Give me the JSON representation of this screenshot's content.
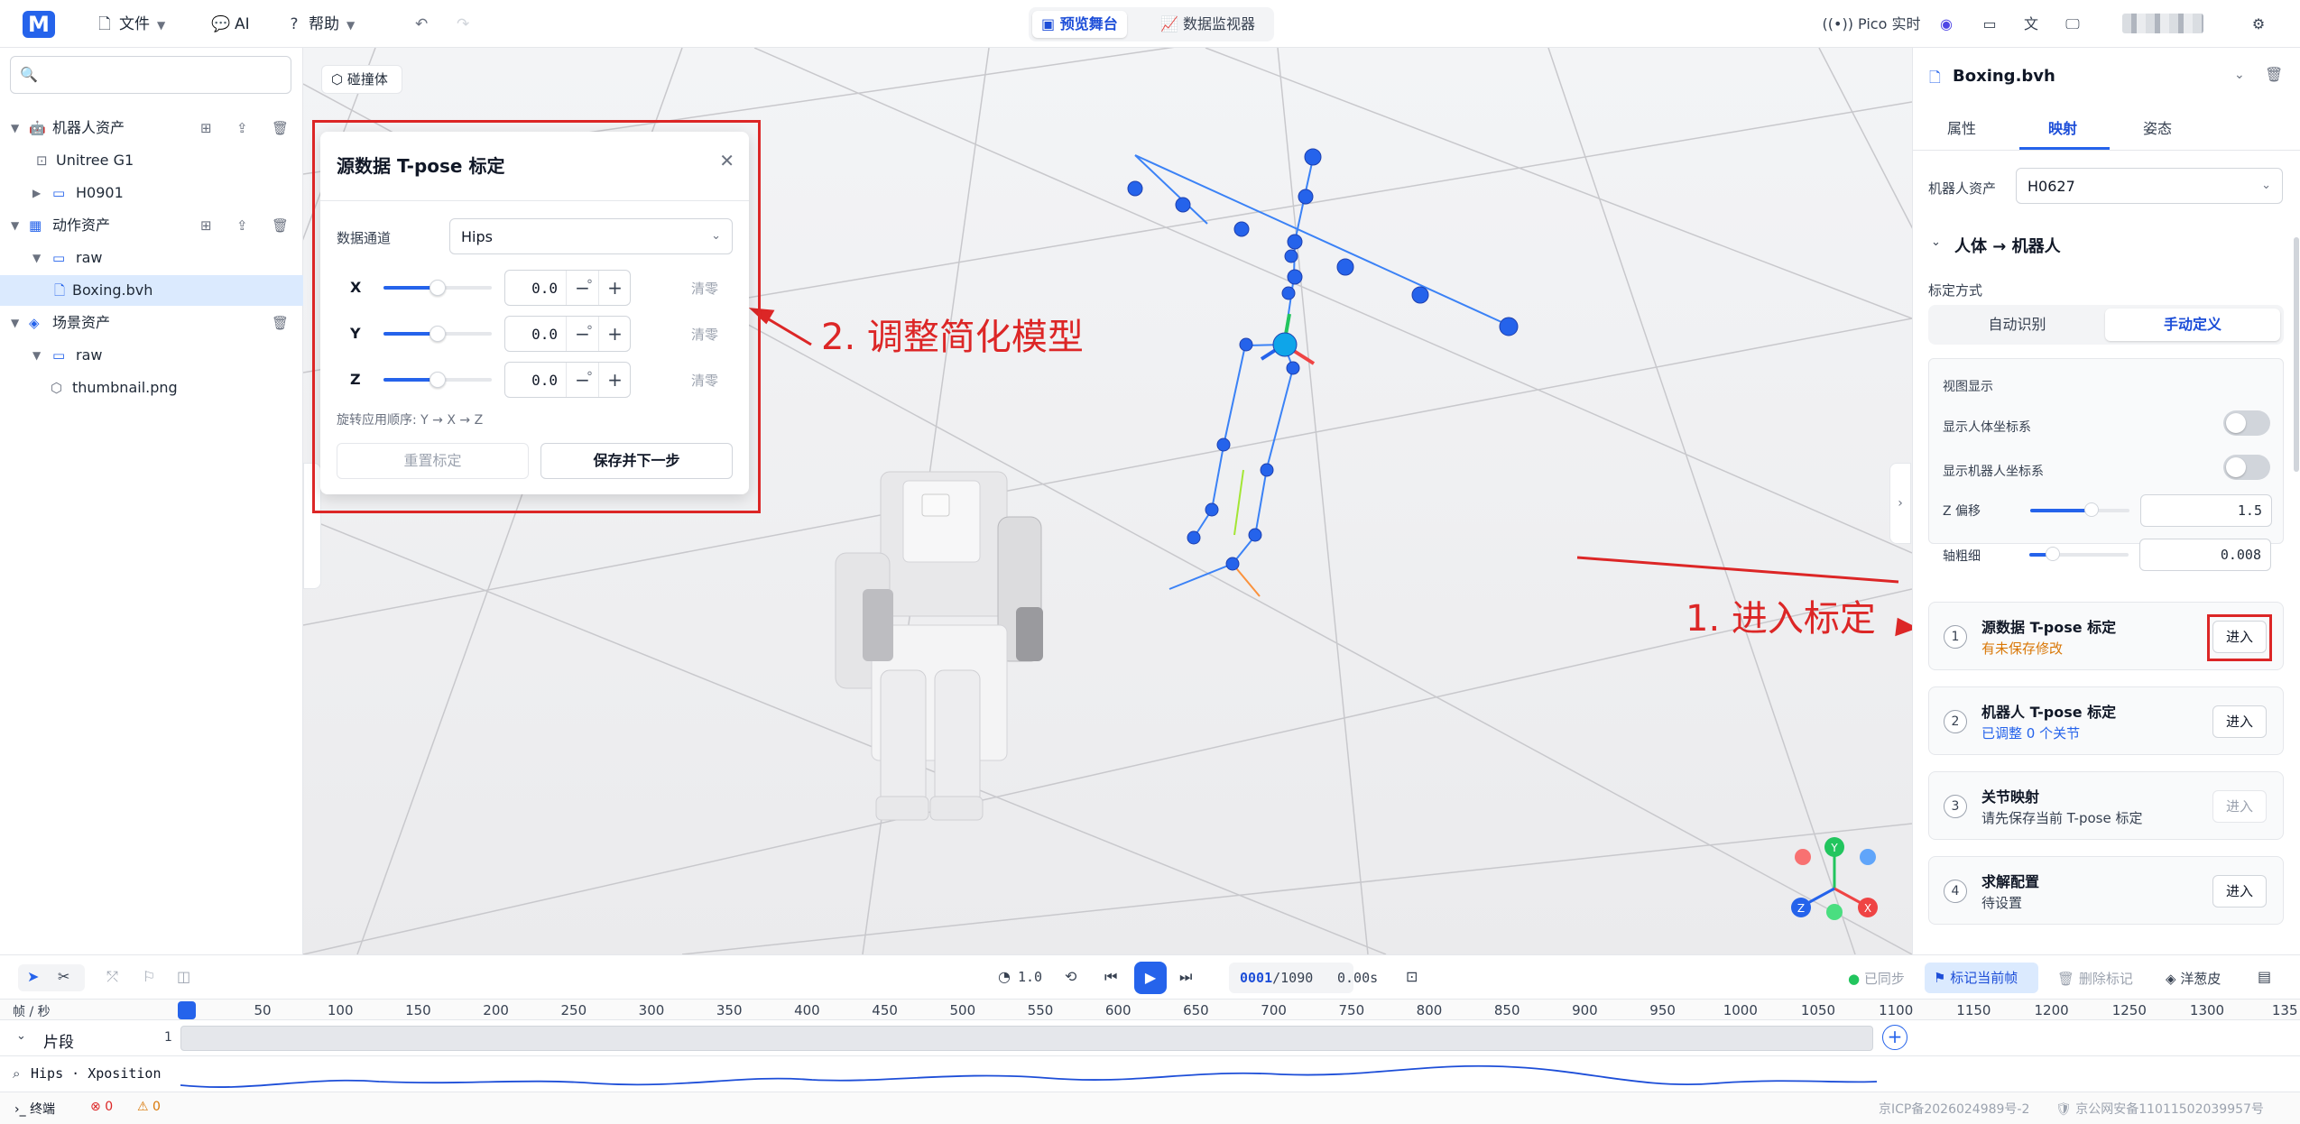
{
  "topbar": {
    "logo": "M",
    "file_label": "文件",
    "ai_label": "AI",
    "help_label": "帮助",
    "tab_preview": "预览舞台",
    "tab_monitor": "数据监视器",
    "pico_label": "Pico 实时"
  },
  "left": {
    "search_placeholder": "",
    "robot_assets": "机器人资产",
    "robot_1": "Unitree G1",
    "robot_2": "H0901",
    "motion_assets": "动作资产",
    "motion_folder": "raw",
    "motion_file": "Boxing.bvh",
    "scene_assets": "场景资产",
    "scene_folder": "raw",
    "scene_file": "thumbnail.png"
  },
  "viewport": {
    "collide_label": "碰撞体",
    "annotation_1": "1. 进入标定",
    "annotation_2": "2. 调整简化模型",
    "gizmo": {
      "y": "Y",
      "x": "X",
      "z": "Z"
    }
  },
  "dialog": {
    "title": "源数据 T-pose 标定",
    "channel_label": "数据通道",
    "channel_value": "Hips",
    "axes": [
      {
        "label": "X",
        "value": "0.0",
        "unit": "°",
        "clear": "清零"
      },
      {
        "label": "Y",
        "value": "0.0",
        "unit": "°",
        "clear": "清零"
      },
      {
        "label": "Z",
        "value": "0.0",
        "unit": "°",
        "clear": "清零"
      }
    ],
    "order_hint": "旋转应用顺序: Y → X → Z",
    "reset_label": "重置标定",
    "save_label": "保存并下一步"
  },
  "right": {
    "file_title": "Boxing.bvh",
    "tab_props": "属性",
    "tab_mapping": "映射",
    "tab_pose": "姿态",
    "robot_asset_label": "机器人资产",
    "robot_asset_value": "H0627",
    "section_title": "人体 → 机器人",
    "calib_mode_label": "标定方式",
    "mode_auto": "自动识别",
    "mode_manual": "手动定义",
    "view_display": "视图显示",
    "show_human_axes": "显示人体坐标系",
    "show_robot_axes": "显示机器人坐标系",
    "z_offset_label": "Z 偏移",
    "z_offset_value": "1.5",
    "axis_width_label": "轴粗细",
    "axis_width_value": "0.008",
    "steps": [
      {
        "num": "1",
        "title": "源数据 T-pose 标定",
        "sub": "有未保存修改",
        "btn": "进入"
      },
      {
        "num": "2",
        "title": "机器人 T-pose 标定",
        "sub": "已调整 0 个关节",
        "btn": "进入"
      },
      {
        "num": "3",
        "title": "关节映射",
        "sub": "请先保存当前 T-pose 标定",
        "btn": "进入"
      },
      {
        "num": "4",
        "title": "求解配置",
        "sub": "待设置",
        "btn": "进入"
      }
    ]
  },
  "timeline": {
    "speed": "1.0",
    "frame_current": "0001",
    "frame_total": "/1090",
    "time": "0.00s",
    "synced": "已同步",
    "mark_frame": "标记当前帧",
    "delete_mark": "删除标记",
    "onion": "洋葱皮",
    "unit_label": "帧 / 秒",
    "ruler": [
      "50",
      "100",
      "150",
      "200",
      "250",
      "300",
      "350",
      "400",
      "450",
      "500",
      "550",
      "600",
      "650",
      "700",
      "750",
      "800",
      "850",
      "900",
      "950",
      "1000",
      "1050",
      "1100",
      "1150",
      "1200",
      "1250",
      "1300",
      "135"
    ],
    "segment_label": "片段",
    "segment_count": "1",
    "curve_label": "Hips · Xposition",
    "terminal": "终端",
    "errors": "0",
    "warnings": "0",
    "icp": "京ICP备2026024989号-2",
    "police": "京公网安备11011502039957号"
  }
}
